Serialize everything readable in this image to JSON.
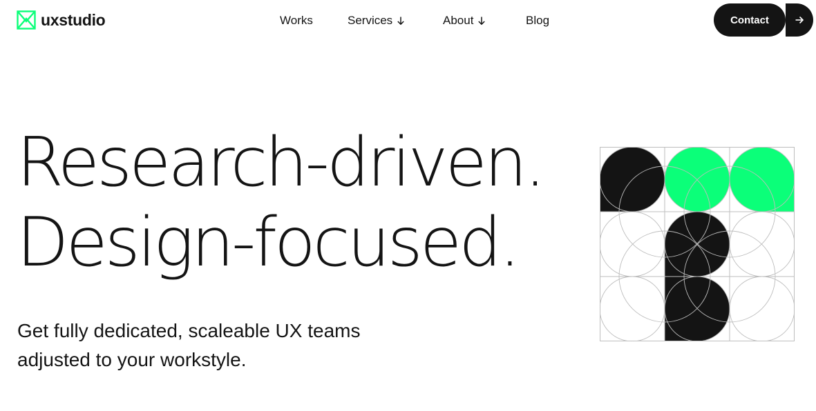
{
  "brand": {
    "name": "uxstudio",
    "accent_color": "#0bff79",
    "dark_color": "#141414"
  },
  "nav": {
    "items": [
      {
        "label": "Works",
        "has_dropdown": false
      },
      {
        "label": "Services",
        "has_dropdown": true
      },
      {
        "label": "About",
        "has_dropdown": true
      },
      {
        "label": "Blog",
        "has_dropdown": false
      }
    ],
    "contact_label": "Contact",
    "contact_icon": "arrow-right-icon",
    "dropdown_icon": "arrow-down-icon"
  },
  "hero": {
    "headline_line1": "Research-driven.",
    "headline_line2": "Design-focused.",
    "subheading_line1": "Get fully dedicated, scaleable UX teams",
    "subheading_line2": "adjusted to your workstyle."
  },
  "illustration": {
    "icon": "geometric-grid-illustration",
    "cells": [
      [
        "dark",
        "accent",
        "accent"
      ],
      [
        "empty",
        "dark",
        "empty"
      ],
      [
        "empty",
        "dark",
        "empty"
      ]
    ]
  }
}
